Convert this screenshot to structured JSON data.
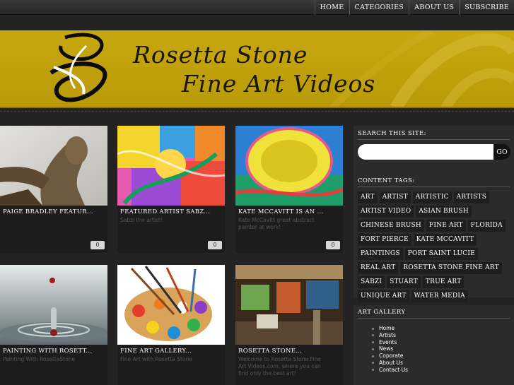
{
  "nav": {
    "items": [
      "HOME",
      "CATEGORIES",
      "ABOUT US",
      "SUBSCRIBE"
    ]
  },
  "banner": {
    "title_line1": "Rosetta Stone",
    "title_line2": "Fine Art Videos"
  },
  "posts": [
    {
      "title": "PAIGE BRADLEY FEATUR...",
      "excerpt": "",
      "comments": "0",
      "thumb": "bronze-sculpture"
    },
    {
      "title": "FEATURED ARTIST SABZ...",
      "excerpt": "Sabzi the artist!",
      "comments": "0",
      "thumb": "colorful-painting"
    },
    {
      "title": "KATE MCCAVITT IS AN ...",
      "excerpt": "Kate McCavitt great abstract painter at work!",
      "comments": "0",
      "thumb": "abstract-yellow-blue"
    },
    {
      "title": "PAINTING WITH ROSETT...",
      "excerpt": "Painting With RosettaStone",
      "comments": "",
      "thumb": "water-drop"
    },
    {
      "title": "FINE ART GALLERY...",
      "excerpt": "Fine Art with Rosetta Stone",
      "comments": "",
      "thumb": "paint-palette"
    },
    {
      "title": "ROSETTA STONE...",
      "excerpt": "Welcome to Rosetta Stone Fine Art Videos.com, where you can find only the best art!",
      "comments": "",
      "thumb": "gallery-interior"
    }
  ],
  "sidebar": {
    "search_title": "SEARCH THIS SITE:",
    "search_placeholder": "",
    "go_label": "GO",
    "tags_title": "CONTENT TAGS:",
    "tags": [
      "ART",
      "ARTIST",
      "ARTISTIC",
      "ARTISTS",
      "ARTIST VIDEO",
      "ASIAN BRUSH",
      "CHINESE BRUSH",
      "FINE ART",
      "FLORIDA",
      "FORT PIERCE",
      "KATE MCCAVITT",
      "PAINTINGS",
      "PORT SAINT LUCIE",
      "REAL ART",
      "ROSETTA STONE FINE ART",
      "SABZI",
      "STUART",
      "TRUE ART",
      "UNIQUE ART",
      "WATER MEDIA"
    ],
    "gallery_title": "ART GALLERY",
    "gallery_links": [
      "Home",
      "Artists",
      "Events",
      "News",
      "Coporate",
      "About Us",
      "Contact Us"
    ]
  },
  "colors": {
    "banner": "#c0a20d",
    "background": "#232323",
    "panel": "#2b2b2b"
  }
}
